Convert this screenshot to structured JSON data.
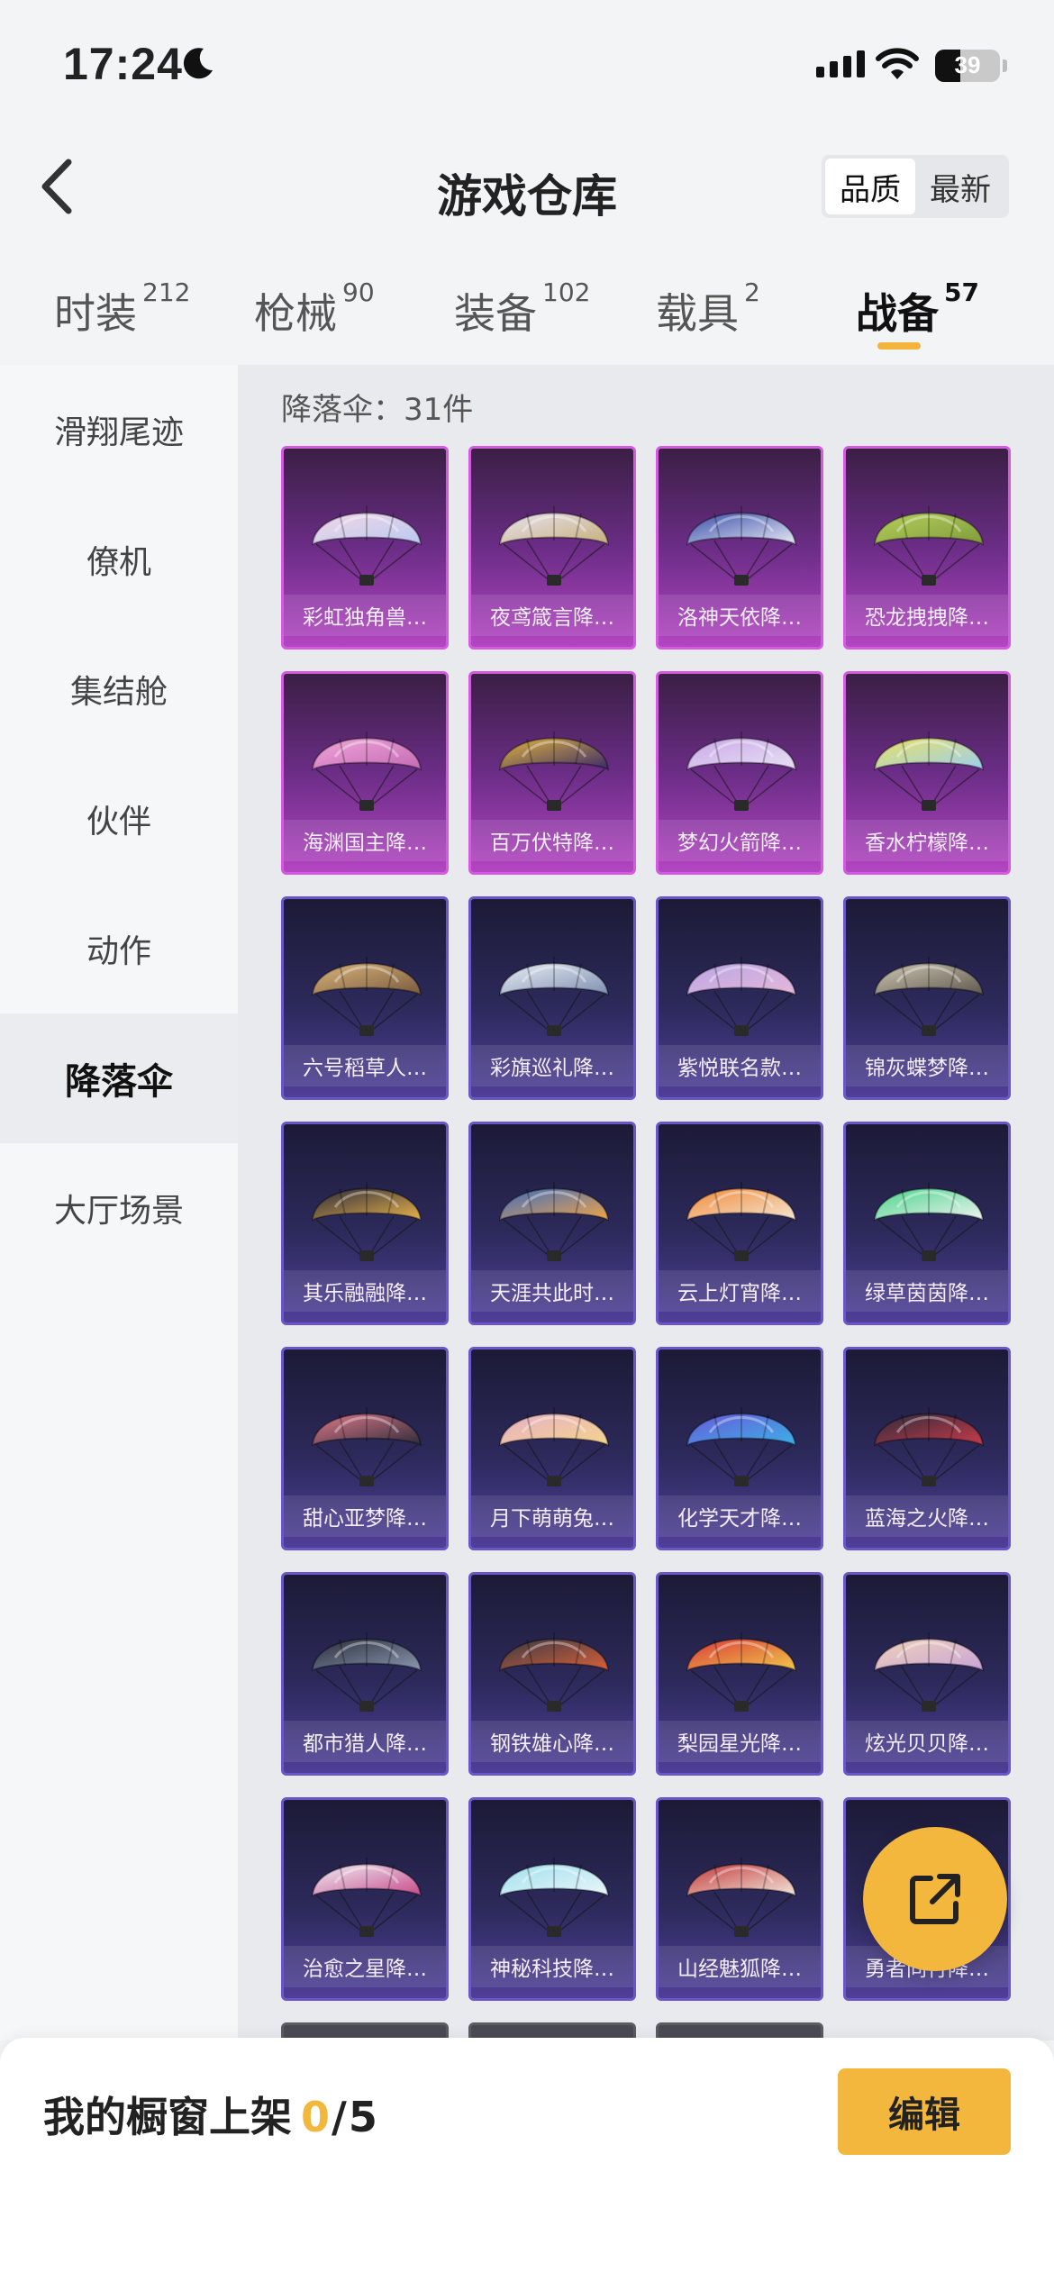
{
  "status_bar": {
    "time": "17:24",
    "battery_percent": "39",
    "battery_level": 0.39
  },
  "header": {
    "title": "游戏仓库",
    "sort_options": [
      "品质",
      "最新"
    ],
    "active_sort": "品质"
  },
  "tabs": [
    {
      "label": "时装",
      "count": "212"
    },
    {
      "label": "枪械",
      "count": "90"
    },
    {
      "label": "装备",
      "count": "102"
    },
    {
      "label": "载具",
      "count": "2"
    },
    {
      "label": "战备",
      "count": "57",
      "active": true
    }
  ],
  "sidebar": {
    "items": [
      {
        "label": "滑翔尾迹"
      },
      {
        "label": "僚机"
      },
      {
        "label": "集结舱"
      },
      {
        "label": "伙伴"
      },
      {
        "label": "动作"
      },
      {
        "label": "降落伞",
        "active": true
      },
      {
        "label": "大厅场景"
      }
    ]
  },
  "content": {
    "count_label": "降落伞：31件",
    "items": [
      {
        "name": "彩虹独角兽…",
        "rarity": "epic",
        "colors": [
          "#f3d7e6",
          "#b9c9f0"
        ]
      },
      {
        "name": "夜鸢箴言降…",
        "rarity": "epic",
        "colors": [
          "#e9e2f1",
          "#c6b07a"
        ]
      },
      {
        "name": "洛神天依降…",
        "rarity": "epic",
        "colors": [
          "#3a4fa8",
          "#e6e8f6"
        ]
      },
      {
        "name": "恐龙拽拽降…",
        "rarity": "epic",
        "colors": [
          "#b6cf5c",
          "#7f9c3a"
        ]
      },
      {
        "name": "海渊国主降…",
        "rarity": "epic",
        "colors": [
          "#f0a6d8",
          "#c46ab5"
        ]
      },
      {
        "name": "百万伏特降…",
        "rarity": "epic",
        "colors": [
          "#e2b53c",
          "#3a2a6a"
        ]
      },
      {
        "name": "梦幻火箭降…",
        "rarity": "epic",
        "colors": [
          "#c9a7e8",
          "#e8e2f4"
        ]
      },
      {
        "name": "香水柠檬降…",
        "rarity": "epic",
        "colors": [
          "#e9e064",
          "#9ccff0"
        ]
      },
      {
        "name": "六号稻草人…",
        "rarity": "rare",
        "colors": [
          "#d9b57c",
          "#7a5a3e"
        ]
      },
      {
        "name": "彩旗巡礼降…",
        "rarity": "rare",
        "colors": [
          "#e9eef5",
          "#7d8fb0"
        ]
      },
      {
        "name": "紫悦联名款…",
        "rarity": "rare",
        "colors": [
          "#b9a6e6",
          "#e5b8d8"
        ]
      },
      {
        "name": "锦灰蝶梦降…",
        "rarity": "rare",
        "colors": [
          "#cfc7b5",
          "#5e584d"
        ]
      },
      {
        "name": "其乐融融降…",
        "rarity": "rare",
        "colors": [
          "#2a2a3a",
          "#e8b14c"
        ]
      },
      {
        "name": "天涯共此时…",
        "rarity": "rare",
        "colors": [
          "#3d6dbf",
          "#f0a348"
        ]
      },
      {
        "name": "云上灯宵降…",
        "rarity": "rare",
        "colors": [
          "#f08a3a",
          "#f4e6d2"
        ]
      },
      {
        "name": "绿草茵茵降…",
        "rarity": "rare",
        "colors": [
          "#48d48a",
          "#f0f3f0"
        ]
      },
      {
        "name": "甜心亚梦降…",
        "rarity": "rare",
        "colors": [
          "#e07a8a",
          "#2e2b3a"
        ]
      },
      {
        "name": "月下萌萌兔…",
        "rarity": "rare",
        "colors": [
          "#e6b0c8",
          "#f4d48a"
        ]
      },
      {
        "name": "化学天才降…",
        "rarity": "rare",
        "colors": [
          "#6a5ad8",
          "#3ab0e8"
        ]
      },
      {
        "name": "蓝海之火降…",
        "rarity": "rare",
        "colors": [
          "#2c2c3c",
          "#c93a4a"
        ]
      },
      {
        "name": "都市猎人降…",
        "rarity": "rare",
        "colors": [
          "#2a2e3c",
          "#8a97b0"
        ]
      },
      {
        "name": "钢铁雄心降…",
        "rarity": "rare",
        "colors": [
          "#3a3a44",
          "#d8603a"
        ]
      },
      {
        "name": "梨园星光降…",
        "rarity": "rare",
        "colors": [
          "#d93a3a",
          "#f0c84a"
        ]
      },
      {
        "name": "炫光贝贝降…",
        "rarity": "rare",
        "colors": [
          "#f0d2b8",
          "#c8a4d8"
        ]
      },
      {
        "name": "治愈之星降…",
        "rarity": "rare",
        "colors": [
          "#eef0f6",
          "#c84a8a"
        ]
      },
      {
        "name": "神秘科技降…",
        "rarity": "rare",
        "colors": [
          "#9fe0ee",
          "#eaf6fa"
        ]
      },
      {
        "name": "山经魅狐降…",
        "rarity": "rare",
        "colors": [
          "#c23a3a",
          "#f2e6dc"
        ]
      },
      {
        "name": "勇者同行降…",
        "rarity": "rare",
        "colors": [
          "#e8a03c",
          "#3a3a5a"
        ]
      },
      {
        "name": "",
        "rarity": "ghost",
        "colors": [
          "#5a5b63",
          "#5a5b63"
        ]
      },
      {
        "name": "",
        "rarity": "ghost",
        "colors": [
          "#5a5b63",
          "#5a5b63"
        ]
      },
      {
        "name": "",
        "rarity": "ghost",
        "colors": [
          "#5a5b63",
          "#5a5b63"
        ]
      }
    ]
  },
  "bottom_bar": {
    "label": "我的橱窗上架",
    "current": "0",
    "slash": "/",
    "total": "5",
    "edit_label": "编辑"
  },
  "icons": {
    "back": "chevron-left-icon",
    "share": "share-external-icon",
    "moon": "moon-icon",
    "wifi": "wifi-icon",
    "signal": "cellular-signal-icon",
    "battery": "battery-icon"
  },
  "colors": {
    "accent": "#f3b73e",
    "epic": "#b345c2",
    "rare": "#4f3f98"
  }
}
